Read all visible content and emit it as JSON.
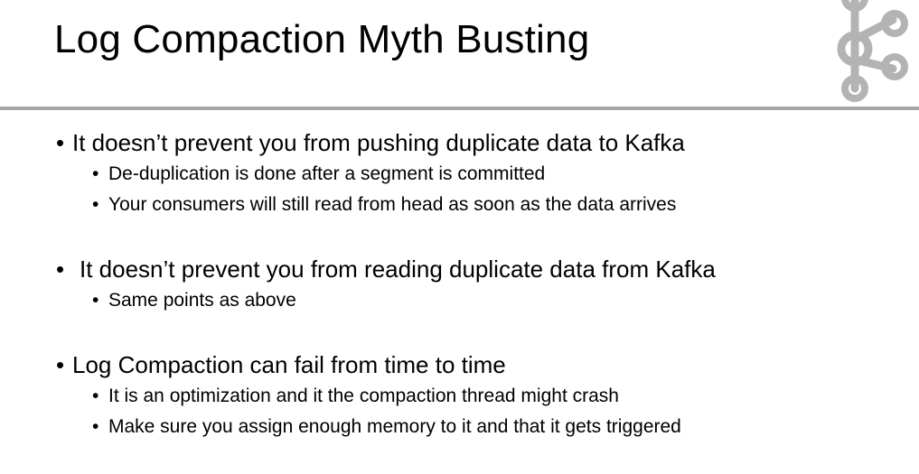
{
  "slide": {
    "title": "Log Compaction Myth Busting",
    "logo_icon": "kafka-logo-icon",
    "rule_color": "#a6a6a6"
  },
  "bullets": [
    {
      "text": "It doesn’t prevent you from pushing duplicate data to Kafka",
      "sub": [
        "De-duplication is done after a segment is committed",
        "Your consumers will still read from head as soon as the data arrives"
      ]
    },
    {
      "text": "It doesn’t prevent you from reading duplicate data from Kafka",
      "sub": [
        "Same points as above"
      ]
    },
    {
      "text": "Log Compaction can fail from time to time",
      "sub": [
        "It is an optimization and it the compaction thread might crash",
        "Make sure you assign enough memory to it and that it gets triggered"
      ]
    }
  ]
}
